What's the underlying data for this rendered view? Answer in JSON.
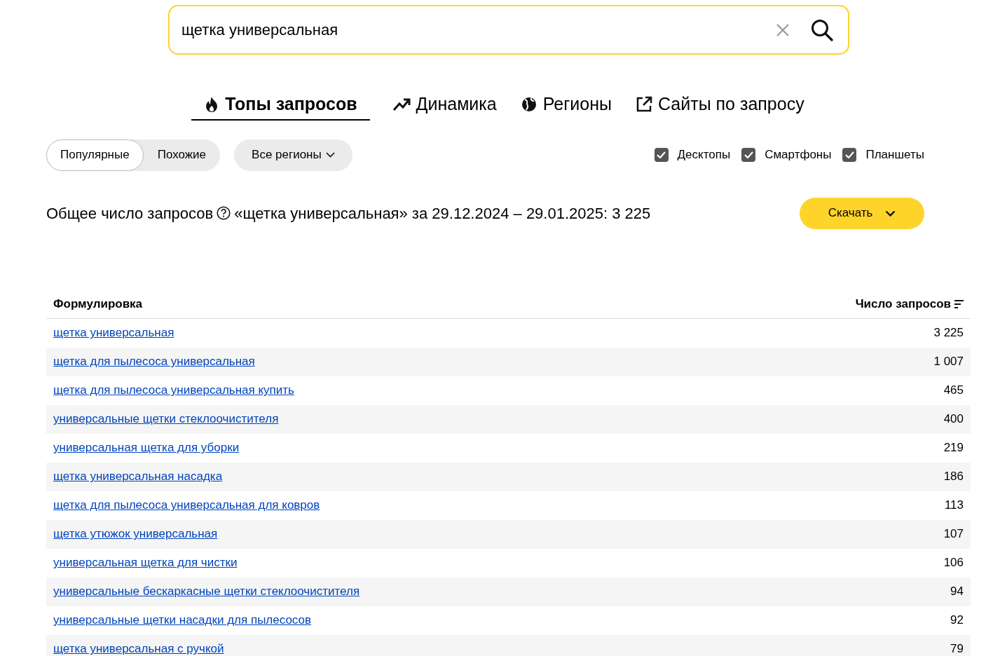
{
  "search": {
    "value": "щетка универсальная"
  },
  "tabs": [
    {
      "label": "Топы запросов",
      "selected": true
    },
    {
      "label": "Динамика",
      "selected": false
    },
    {
      "label": "Регионы",
      "selected": false
    },
    {
      "label": "Сайты по запросу",
      "selected": false
    }
  ],
  "segments": [
    {
      "label": "Популярные",
      "selected": true
    },
    {
      "label": "Похожие",
      "selected": false
    }
  ],
  "region_dropdown": {
    "label": "Все регионы"
  },
  "devices": [
    {
      "label": "Десктопы",
      "checked": true
    },
    {
      "label": "Смартфоны",
      "checked": true
    },
    {
      "label": "Планшеты",
      "checked": true
    }
  ],
  "summary": {
    "label": "Общее число запросов",
    "text": "«щетка универсальная» за 29.12.2024 – 29.01.2025: 3 225"
  },
  "download_button": "Скачать",
  "table": {
    "columns": [
      "Формулировка",
      "Число запросов"
    ],
    "rows": [
      {
        "phrase": "щетка универсальная",
        "count": "3 225"
      },
      {
        "phrase": "щетка для пылесоса универсальная",
        "count": "1 007"
      },
      {
        "phrase": "щетка для пылесоса универсальная купить",
        "count": "465"
      },
      {
        "phrase": "универсальные щетки стеклоочистителя",
        "count": "400"
      },
      {
        "phrase": "универсальная щетка для уборки",
        "count": "219"
      },
      {
        "phrase": "щетка универсальная насадка",
        "count": "186"
      },
      {
        "phrase": "щетка для пылесоса универсальная для ковров",
        "count": "113"
      },
      {
        "phrase": "щетка утюжок универсальная",
        "count": "107"
      },
      {
        "phrase": "универсальная щетка для чистки",
        "count": "106"
      },
      {
        "phrase": "универсальные бескаркасные щетки стеклоочистителя",
        "count": "94"
      },
      {
        "phrase": "универсальные щетки насадки для пылесосов",
        "count": "92"
      },
      {
        "phrase": "щетка универсальная с ручкой",
        "count": "79"
      }
    ]
  }
}
